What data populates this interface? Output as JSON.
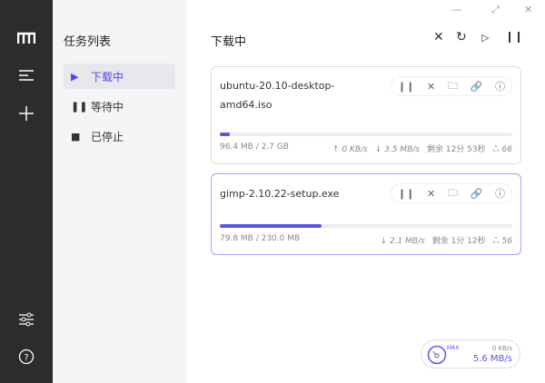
{
  "rail": {
    "icons": [
      "logo-icon",
      "menu-icon",
      "add-icon",
      "settings-sliders-icon",
      "help-icon"
    ]
  },
  "sidebar": {
    "title": "任务列表",
    "items": [
      {
        "label": "下载中",
        "icon": "play-icon"
      },
      {
        "label": "等待中",
        "icon": "pause-icon"
      },
      {
        "label": "已停止",
        "icon": "stop-icon"
      }
    ]
  },
  "header": {
    "title": "下载中"
  },
  "tasks": [
    {
      "name": "ubuntu-20.10-desktop-amd64.iso",
      "progress": 0.035,
      "size": "96.4 MB / 2.7 GB",
      "upload": "↑ 0 KB/s",
      "download": "↓ 3.5 MB/s",
      "remaining": "剩余 12分 53秒",
      "peers": "66"
    },
    {
      "name": "gimp-2.10.22-setup.exe",
      "progress": 0.347,
      "size": "79.8 MB / 230.0 MB",
      "download": "↓ 2.1 MB/s",
      "remaining": "剩余 1分 12秒",
      "peers": "56"
    }
  ],
  "speedometer": {
    "max_label": "MAX",
    "upload": "0 KB/s",
    "download": "5.6 MB/s"
  },
  "colors": {
    "accent": "#5b54e8",
    "rail": "#2c2c2e"
  }
}
